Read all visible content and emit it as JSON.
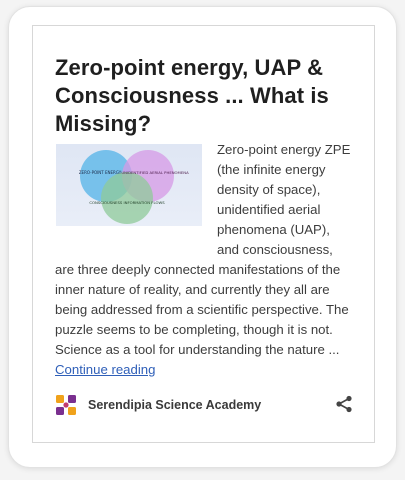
{
  "post": {
    "title": "Zero-point energy, UAP & Consciousness ... What is Missing?",
    "excerpt": "Zero-point energy ZPE (the infinite energy density of space), unidentified aerial phenomena (UAP), and consciousness, are three deeply connected manifestations of the inner nature of reality, and currently they all are being addressed from a scientific perspective. The puzzle seems to be completing, though it is not. Science as a tool for understanding the nature ... ",
    "continue_label": "Continue reading"
  },
  "thumbnail": {
    "circle_zpe": "ZERO-POINT ENERGY",
    "circle_uap": "UNIDENTIFIED AERIAL PHENOMENA",
    "circle_consciousness": "CONSCIOUSNESS INFORMATION FLOWS",
    "colors": {
      "zpe": "#5bb7e8",
      "uap": "#d59ae6",
      "consciousness": "#8fc99a"
    }
  },
  "footer": {
    "site_name": "Serendipia Science Academy",
    "share_icon": "share-icon",
    "logo_icon": "site-logo-icon"
  }
}
